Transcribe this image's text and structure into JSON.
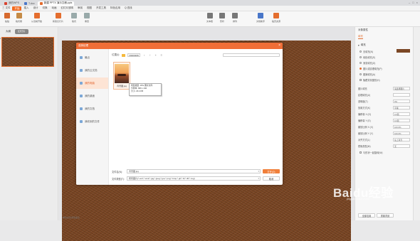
{
  "titlebar": {
    "tabs": [
      {
        "label": "我的WPS",
        "color": "#d8422f"
      },
      {
        "label": "T-doc",
        "color": "#4a77c9"
      },
      {
        "label": "新建 PPTX 演示文稿.pptx",
        "color": "#e26b2e",
        "active": true
      }
    ]
  },
  "menubar": {
    "items": [
      "三 文件",
      "开始",
      "插入",
      "设计",
      "切换",
      "动画",
      "幻灯片放映",
      "审阅",
      "视图",
      "开发工具",
      "特色应用"
    ],
    "active_index": 1,
    "search": "Q 查找"
  },
  "ribbon": {
    "groups": [
      "粘贴",
      "格式刷",
      "从当前开始",
      "新建幻灯片",
      "版式",
      "重置",
      "文本框",
      "形状",
      "排列",
      "文档助手",
      "稻壳资源"
    ]
  },
  "thumbpanel": {
    "tabs": [
      "大纲",
      "幻灯片"
    ],
    "active_tab": 1,
    "slide_number": "1"
  },
  "notes": {
    "placeholder": "单击此处添加备注"
  },
  "dialog": {
    "title": "选择纹理",
    "sidebar": [
      {
        "label": "最近",
        "icon": "clock-icon"
      },
      {
        "label": "我的云文档",
        "icon": "cloud-icon"
      },
      {
        "label": "我的电脑",
        "icon": "computer-icon",
        "active": true
      },
      {
        "label": "我的桌面",
        "icon": "desktop-icon"
      },
      {
        "label": "我的文档",
        "icon": "documents-icon"
      },
      {
        "label": "我收到的文件",
        "icon": "inbox-icon"
      }
    ],
    "location_label": "位置(I):",
    "location_value": "20200208",
    "file": {
      "name": "背景图.jpg"
    },
    "tooltip": {
      "line1": "项目类型: JPG 图片文件",
      "line2": "分辨率: 680 x 440",
      "line3": "大小: 29.4 KB"
    },
    "filename_label": "文件名(N):",
    "filename_value": "背景图.jpg",
    "filetype_label": "文件类型(T):",
    "filetype_value": "所有图片(*.emf;*.wmf;*.jpg;*.jpeg;*.jpe;*.png;*.bmp;*.gif;*.tif;*.tiff;*.svg)",
    "open_button": "打开(O)",
    "cancel_button": "取消"
  },
  "rightpanel": {
    "title": "对象属性",
    "tabs": [
      "填充"
    ],
    "section": "填充",
    "options": [
      {
        "label": "无填充(N)",
        "type": "radio",
        "on": false
      },
      {
        "label": "纯色填充(S)",
        "type": "radio",
        "on": false
      },
      {
        "label": "渐变填充(G)",
        "type": "radio",
        "on": false
      },
      {
        "label": "图片或纹理填充(P)",
        "type": "radio",
        "on": true
      },
      {
        "label": "图案填充(A)",
        "type": "radio",
        "on": false
      },
      {
        "label": "隐藏背景图形(H)",
        "type": "check",
        "on": false
      }
    ],
    "props": [
      {
        "label": "图片填充",
        "value": "请选择图片"
      },
      {
        "label": "纹理填充(U)",
        "value": ""
      },
      {
        "label": "透明度(T)",
        "value": "0%"
      },
      {
        "label": "放置方式(K)",
        "value": "平铺"
      },
      {
        "label": "偏移量 X (O)",
        "value": "0.0磅"
      },
      {
        "label": "偏移量 Y (E)",
        "value": "0.0磅"
      },
      {
        "label": "缩放比例 X (X)",
        "value": "100.0%"
      },
      {
        "label": "缩放比例 Y (Y)",
        "value": "100.0%"
      },
      {
        "label": "对齐方式(L)",
        "value": "左上对齐"
      },
      {
        "label": "镜像类型(M)",
        "value": "无"
      }
    ],
    "rotate_check": "与形状一起旋转(W)",
    "bottom_buttons": [
      "全部应用",
      "重置背景"
    ]
  },
  "watermark": {
    "brand": "Baidu经验",
    "url": "jingyan.baidu.com"
  }
}
